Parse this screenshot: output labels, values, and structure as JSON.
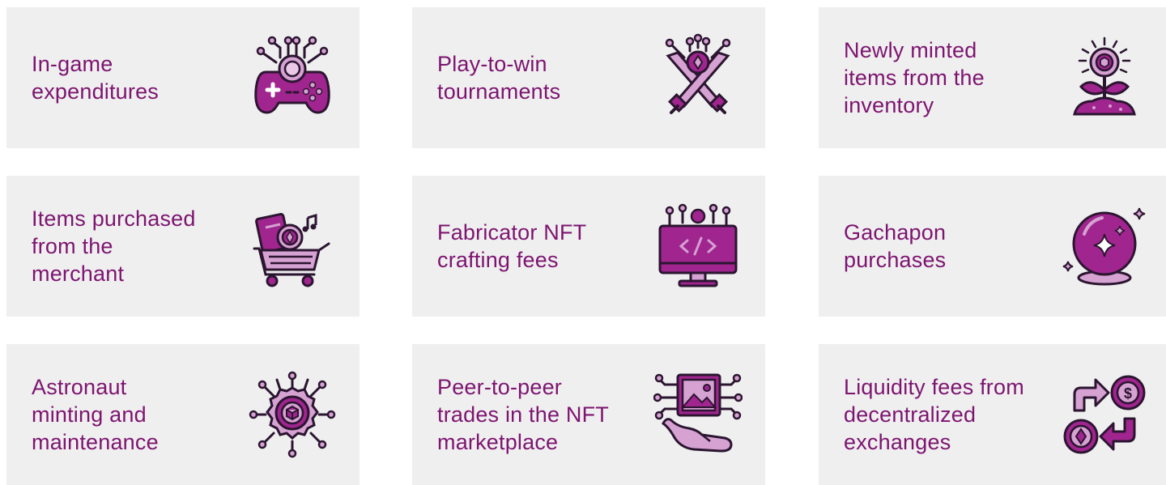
{
  "colors": {
    "text": "#7d1470",
    "card_bg": "#efefef",
    "icon_primary": "#a0258f",
    "icon_light": "#d5a2d2",
    "icon_stroke": "#2b1530"
  },
  "cards": [
    {
      "label": "In-game\nexpenditures",
      "icon": "gamepad-icon"
    },
    {
      "label": "Play-to-win\ntournaments",
      "icon": "crossed-swords-icon"
    },
    {
      "label": "Newly minted\nitems from the\ninventory",
      "icon": "sprouting-coin-icon"
    },
    {
      "label": "Items purchased\nfrom the\nmerchant",
      "icon": "shopping-cart-icon"
    },
    {
      "label": "Fabricator NFT\ncrafting fees",
      "icon": "code-monitor-icon"
    },
    {
      "label": "Gachapon\npurchases",
      "icon": "crystal-ball-icon"
    },
    {
      "label": "Astronaut\nminting and\nmaintenance",
      "icon": "gear-cube-icon"
    },
    {
      "label": "Peer-to-peer\ntrades in the NFT\nmarketplace",
      "icon": "hand-image-icon"
    },
    {
      "label": "Liquidity fees from\ndecentralized\nexchanges",
      "icon": "coin-exchange-icon"
    }
  ]
}
